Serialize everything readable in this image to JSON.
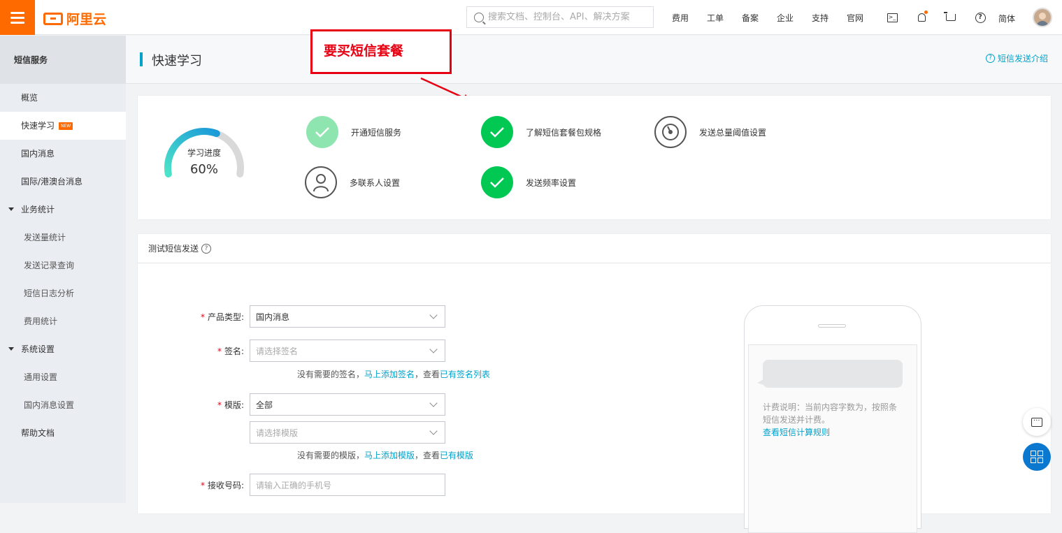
{
  "header": {
    "logo_text": "阿里云",
    "search_placeholder": "搜索文档、控制台、API、解决方案",
    "nav": [
      "费用",
      "工单",
      "备案",
      "企业",
      "支持",
      "官网"
    ],
    "icons": [
      "terminal-icon",
      "bell-icon",
      "cart-icon",
      "help-icon"
    ],
    "lang": "简体"
  },
  "sidebar": {
    "title": "短信服务",
    "items": [
      {
        "label": "概览"
      },
      {
        "label": "快速学习",
        "badge": "NEW"
      },
      {
        "label": "国内消息"
      },
      {
        "label": "国际/港澳台消息"
      },
      {
        "label": "业务统计"
      },
      {
        "label": "发送量统计"
      },
      {
        "label": "发送记录查询"
      },
      {
        "label": "短信日志分析"
      },
      {
        "label": "费用统计"
      },
      {
        "label": "系统设置"
      },
      {
        "label": "通用设置"
      },
      {
        "label": "国内消息设置"
      },
      {
        "label": "帮助文档"
      }
    ]
  },
  "page": {
    "title": "快速学习",
    "help_link": "短信发送介绍",
    "annotation": "要买短信套餐"
  },
  "progress": {
    "label": "学习进度",
    "value_text": "60%",
    "value": 0.6
  },
  "steps": [
    {
      "label": "开通短信服务",
      "status": "done-light"
    },
    {
      "label": "了解短信套餐包规格",
      "status": "done"
    },
    {
      "label": "发送总量阈值设置",
      "status": "todo"
    },
    {
      "label": "多联系人设置",
      "status": "todo"
    },
    {
      "label": "发送频率设置",
      "status": "done"
    }
  ],
  "test_send": {
    "title": "测试短信发送",
    "product_type": {
      "label": "产品类型",
      "value": "国内消息"
    },
    "signature": {
      "label": "签名",
      "placeholder": "请选择签名"
    },
    "signature_hint": {
      "prefix": "没有需要的签名，",
      "link1": "马上添加签名",
      "mid": "，查看",
      "link2": "已有签名列表"
    },
    "template": {
      "label": "模版",
      "value": "全部",
      "placeholder": "请选择模版"
    },
    "template_hint": {
      "prefix": "没有需要的模版，",
      "link1": "马上添加模版",
      "mid": "，查看",
      "link2": "已有模版"
    },
    "phone": {
      "label": "接收号码",
      "placeholder": "请输入正确的手机号"
    },
    "billing_note": "计费说明：当前内容字数为，按照条短信发送并计费。",
    "billing_link": "查看短信计算规则"
  },
  "colors": {
    "accent": "#ff6a00",
    "link": "#00a2ca",
    "success": "#00c853",
    "annotation": "#e60012"
  }
}
